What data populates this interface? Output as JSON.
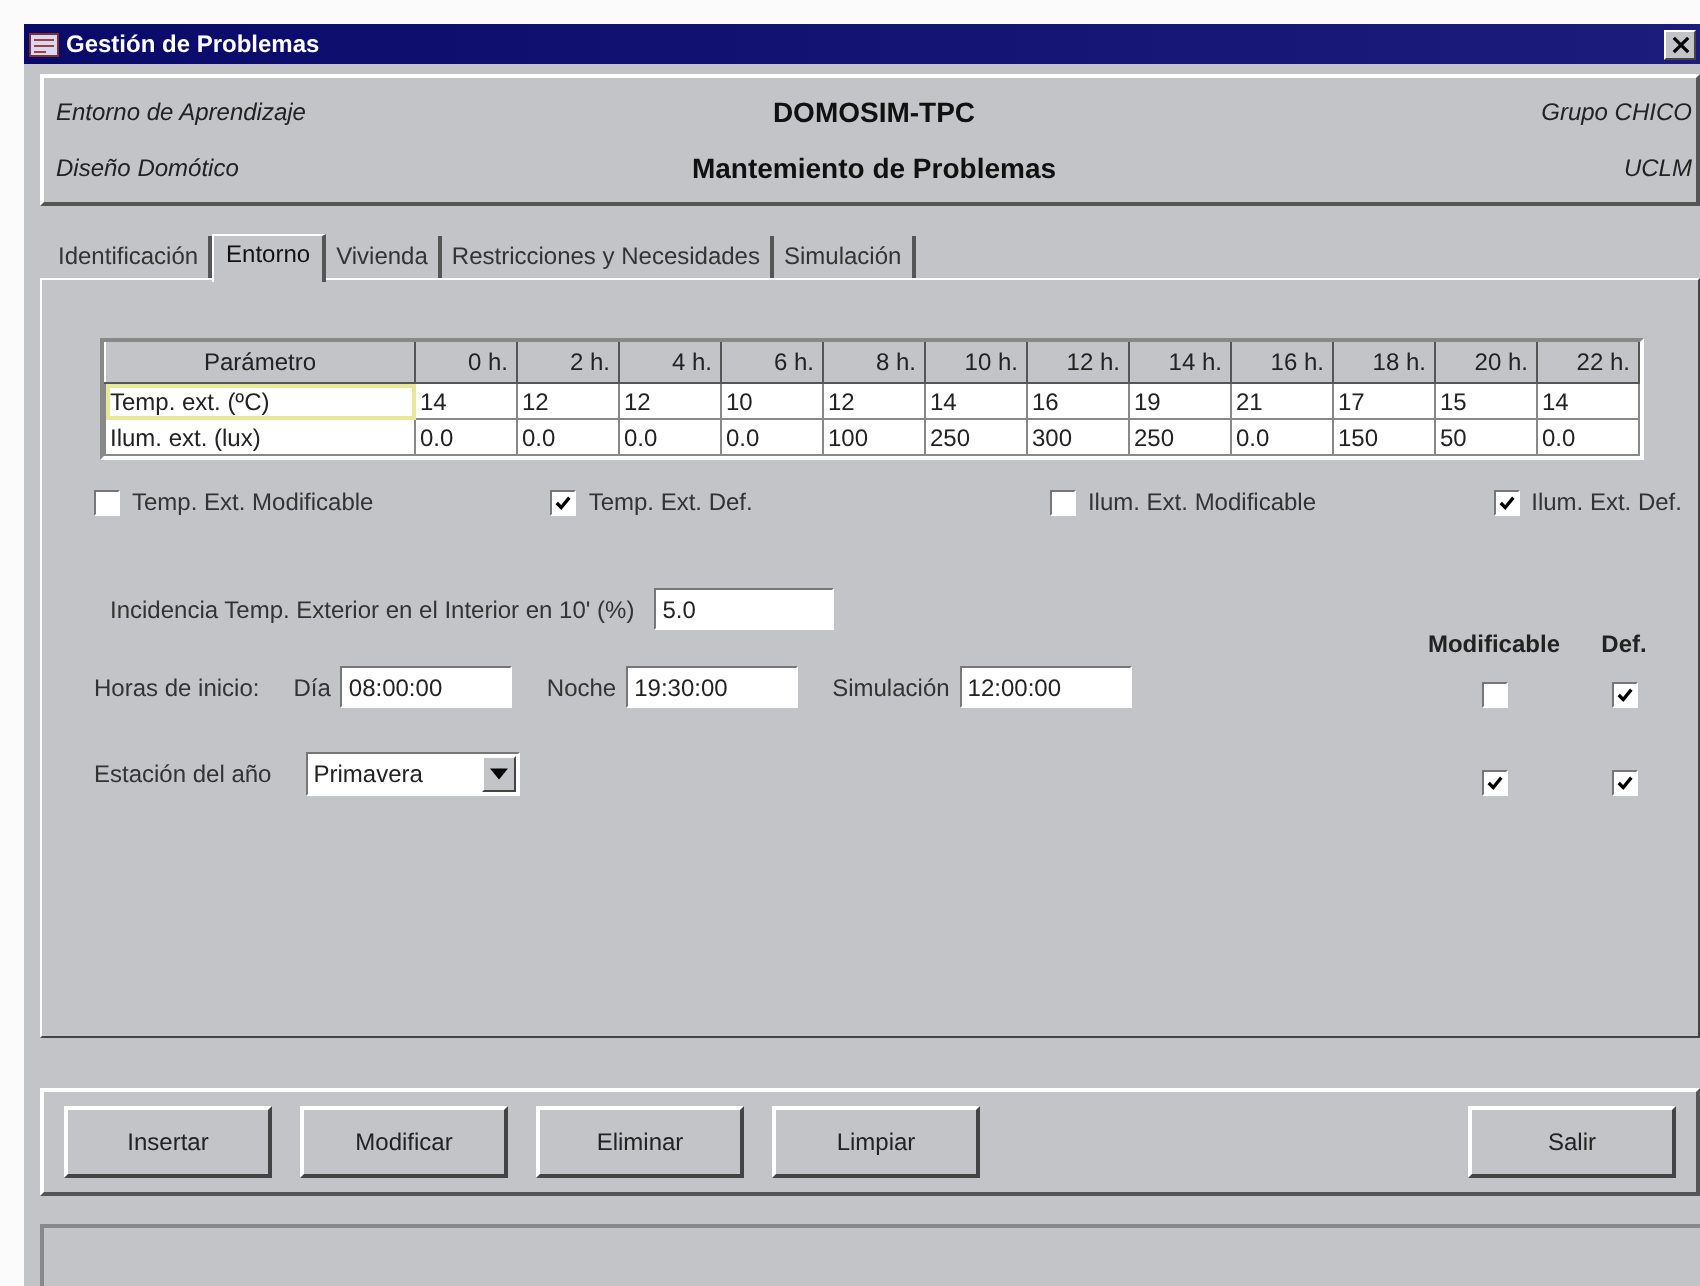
{
  "window": {
    "title": "Gestión de Problemas"
  },
  "header": {
    "left": [
      "Entorno de Aprendizaje",
      "Diseño Domótico"
    ],
    "center": [
      "DOMOSIM-TPC",
      "Mantemiento de Problemas"
    ],
    "right": [
      "Grupo CHICO",
      "UCLM"
    ]
  },
  "tabs": [
    {
      "label": "Identificación",
      "selected": false
    },
    {
      "label": "Entorno",
      "selected": true
    },
    {
      "label": "Vivienda",
      "selected": false
    },
    {
      "label": "Restricciones y Necesidades",
      "selected": false
    },
    {
      "label": "Simulación",
      "selected": false
    }
  ],
  "table": {
    "columns": [
      "Parámetro",
      "0 h.",
      "2 h.",
      "4 h.",
      "6 h.",
      "8 h.",
      "10 h.",
      "12 h.",
      "14 h.",
      "16 h.",
      "18 h.",
      "20 h.",
      "22 h."
    ],
    "rows": [
      {
        "selected": true,
        "cells": [
          "Temp. ext. (ºC)",
          "14",
          "12",
          "12",
          "10",
          "12",
          "14",
          "16",
          "19",
          "21",
          "17",
          "15",
          "14"
        ]
      },
      {
        "selected": false,
        "cells": [
          "Ilum. ext. (lux)",
          "0.0",
          "0.0",
          "0.0",
          "0.0",
          "100",
          "250",
          "300",
          "250",
          "0.0",
          "150",
          "50",
          "0.0"
        ]
      }
    ]
  },
  "options": [
    {
      "label": "Temp. Ext. Modificable",
      "checked": false
    },
    {
      "label": "Temp. Ext. Def.",
      "checked": true
    },
    {
      "label": "Ilum. Ext. Modificable",
      "checked": false
    },
    {
      "label": "Ilum. Ext. Def.",
      "checked": true
    }
  ],
  "incidence": {
    "label": "Incidencia Temp. Exterior en el Interior en 10' (%)",
    "value": "5.0"
  },
  "flag_columns": [
    "Modificable",
    "Def."
  ],
  "start_times": {
    "label": "Horas de inicio:",
    "fields": [
      {
        "label": "Día",
        "value": "08:00:00"
      },
      {
        "label": "Noche",
        "value": "19:30:00"
      },
      {
        "label": "Simulación",
        "value": "12:00:00"
      }
    ],
    "modifiable": false,
    "default": true
  },
  "season": {
    "label": "Estación del año",
    "value": "Primavera",
    "modifiable": true,
    "default": true
  },
  "buttons": [
    "Insertar",
    "Modificar",
    "Eliminar",
    "Limpiar"
  ],
  "exit_button": "Salir"
}
